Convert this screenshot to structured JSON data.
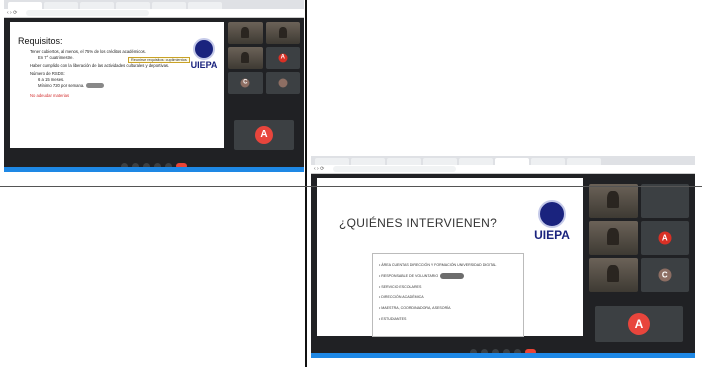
{
  "screenshot_top": {
    "browser_tabs": [
      "",
      "",
      "",
      "",
      "",
      "",
      ""
    ],
    "url": "",
    "slide": {
      "title": "Requisitos:",
      "lines": [
        "Tener cubiertos, al menos, el 75% de los créditos académicos.",
        "En 7° cuatrimestre.",
        "Haber cumplido con la liberación de las actividades culturales y deportivas.",
        "Número de RSDS:",
        "6 a 15 meses.",
        "Mínimo 720 por semana."
      ],
      "tooltip": "Reunirse requisitos: cuplimientos",
      "red_note": "No adeudar materias",
      "logo_text": "UIEPA"
    },
    "participant_avatar": "A",
    "small_avatars": [
      "A",
      "C"
    ]
  },
  "screenshot_bottom": {
    "browser_tabs": [
      "",
      "",
      "",
      "",
      "",
      "",
      "",
      ""
    ],
    "url": "",
    "slide": {
      "title": "¿QUIÉNES INTERVIENEN?",
      "items": [
        "ÁREA CUENTAS DIRECCIÓN Y FORMACIÓN UNIVERSIDAD DIGITAL",
        "RESPONSABLE DE VOLUNTARIO",
        "SERVICIO ESCOLARES",
        "DIRECCIÓN ACADÉMICA",
        "MAESTRA, COORDINADORA, ASESORÍA",
        "ESTUDIANTES"
      ],
      "logo_text": "UIEPA"
    },
    "participant_avatar": "A",
    "small_avatars": [
      "A",
      "C"
    ]
  },
  "colors": {
    "meet_dark": "#202124",
    "avatar_red": "#e8453c",
    "logo_navy": "#1a237e"
  }
}
